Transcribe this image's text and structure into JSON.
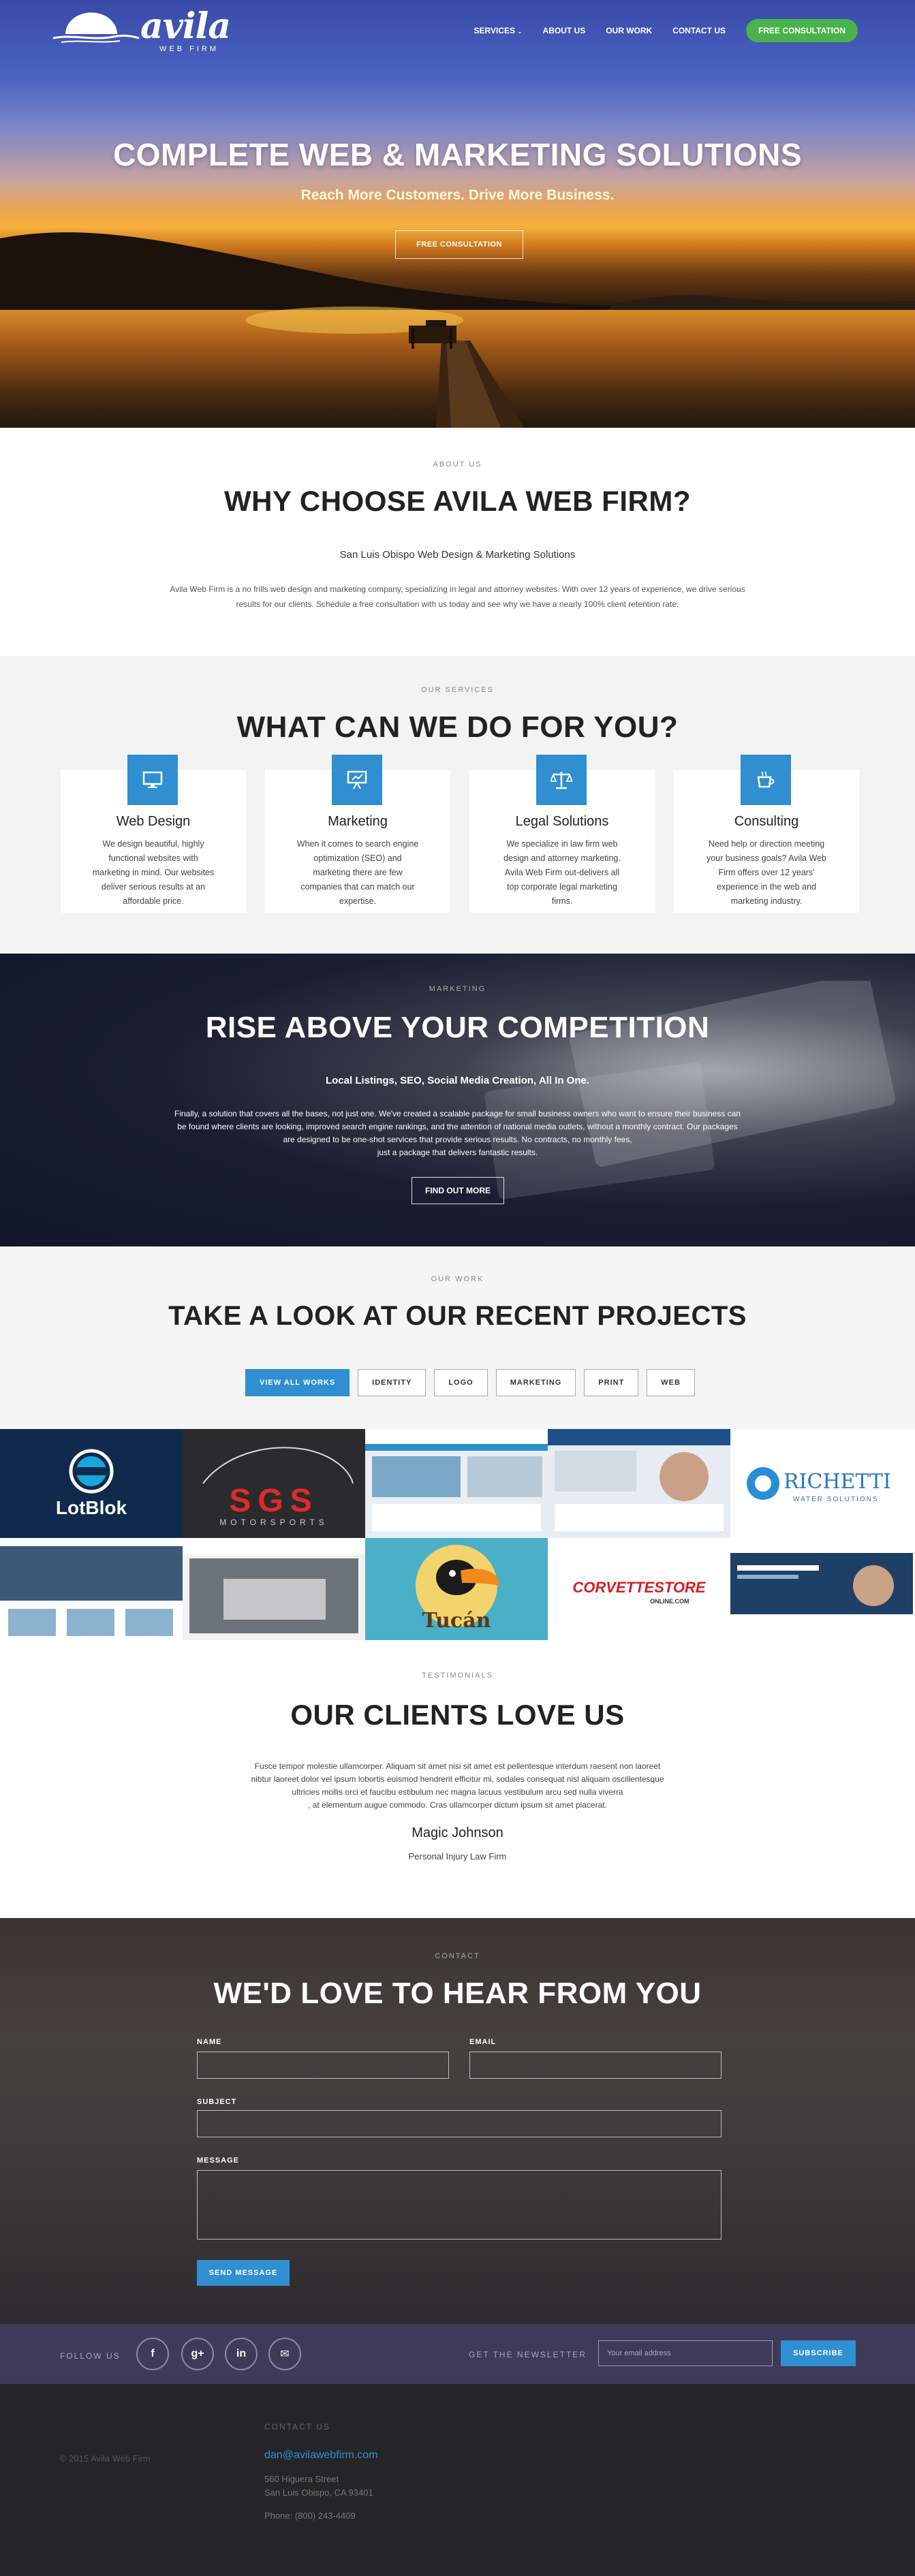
{
  "nav": {
    "logo_word": "avila",
    "logo_sub": "WEB FIRM",
    "items": [
      "SERVICES",
      "ABOUT US",
      "OUR WORK",
      "CONTACT US"
    ],
    "cta": "FREE CONSULTATION"
  },
  "hero": {
    "title": "COMPLETE WEB & MARKETING SOLUTIONS",
    "subtitle": "Reach More Customers. Drive More Business.",
    "button": "FREE CONSULTATION"
  },
  "about": {
    "kicker": "ABOUT US",
    "title": "WHY CHOOSE AVILA WEB FIRM?",
    "subtitle": "San Luis Obispo Web Design & Marketing Solutions",
    "body_line1": "Avila Web Firm is a no frills web design and marketing company, specializing in legal and attorney websites. With over 12 years of experience, we drive serious",
    "body_line2": "results for our clients. Schedule a free consultation with us today and see why we have a nearly 100% client retention rate."
  },
  "services": {
    "kicker": "OUR SERVICES",
    "title": "WHAT CAN WE DO FOR YOU?",
    "cards": [
      {
        "icon": "monitor-icon",
        "title": "Web Design",
        "text": "We design beautiful, highly functional websites with marketing in mind. Our websites deliver serious results at an affordable price."
      },
      {
        "icon": "presentation-icon",
        "title": "Marketing",
        "text": "When it comes to search engine optimization (SEO) and marketing there are few companies that can match our expertise."
      },
      {
        "icon": "scales-icon",
        "title": "Legal Solutions",
        "text": "We specialize in law firm web design and attorney marketing. Avila Web Firm out-delivers all top corporate legal marketing firms."
      },
      {
        "icon": "coffee-icon",
        "title": "Consulting",
        "text": "Need help or direction meeting your business goals? Avila Web Firm offers over 12 years' experience in the web and marketing industry."
      }
    ]
  },
  "marketing": {
    "kicker": "MARKETING",
    "title": "RISE ABOVE YOUR COMPETITION",
    "subtitle": "Local Listings, SEO, Social Media Creation, All In One.",
    "line1": "Finally, a solution that covers all the bases, not just one. We've created a scalable package for small business owners who want to ensure their business can",
    "line2": "be found where clients are looking, improved search engine rankings, and the attention of national media outlets, without a monthly contract. Our packages",
    "line3": "are designed to be one-shot services that provide serious results. No contracts, no monthly fees,",
    "line4": "just a package that delivers fantastic results.",
    "button": "FIND OUT MORE"
  },
  "work": {
    "kicker": "OUR WORK",
    "title": "TAKE A LOOK AT OUR RECENT PROJECTS",
    "filters": [
      "VIEW ALL WORKS",
      "IDENTITY",
      "LOGO",
      "MARKETING",
      "PRINT",
      "WEB"
    ],
    "tiles": {
      "lotblok": "LotBlok",
      "sgs": "SGS",
      "sgs_sub": "MOTORSPORTS",
      "richetti": "RICHETTI",
      "richetti_sub": "WATER SOLUTIONS",
      "tucan": "Tucán",
      "corvette": "CORVETTESTORE",
      "corvette_sub": "ONLINE.COM"
    }
  },
  "testimonials": {
    "kicker": "TESTIMONIALS",
    "title": "OUR CLIENTS LOVE US",
    "quote_line1": "Fusce tempor molestie ullamcorper. Aliquam sit amet nisi sit amet est pellentesque interdum raesent non laoreet",
    "quote_line2": "nibtur laoreet dolor vel ipsum lobortis euismod hendrerit efficitur mi, sodales consequat nisl aliquam oscillentesque",
    "quote_line3": "ultricies mollis orci et faucibu estibulum nec magna lacuus vestibulum arcu sed nulla viverra",
    "quote_line4": ", at elementum augue commodo. Cras ullamcorper dictum ipsum sit amet placerat.",
    "name": "Magic Johnson",
    "role": "Personal Injury Law Firm"
  },
  "contact": {
    "kicker": "CONTACT",
    "title": "WE'D LOVE TO HEAR FROM YOU",
    "name_label": "NAME",
    "email_label": "EMAIL",
    "subject_label": "SUBJECT",
    "message_label": "MESSAGE",
    "send": "SEND MESSAGE"
  },
  "follow": {
    "label": "FOLLOW US",
    "newsletter_label": "GET THE NEWSLETTER",
    "email_placeholder": "Your email address",
    "subscribe": "SUBSCRIBE"
  },
  "footer": {
    "copyright": "© 2015 Avila Web Firm",
    "contact_label": "CONTACT US",
    "email": "dan@avilawebfirm.com",
    "street": "560 Higuera Street",
    "city": "San Luis Obispo, CA 93401",
    "phone": "Phone: (800) 243-4409"
  },
  "colors": {
    "accent_blue": "#2f8fd1",
    "cta_green": "#49b24a",
    "follow_bar": "#3e3a58",
    "footer": "#252527"
  }
}
